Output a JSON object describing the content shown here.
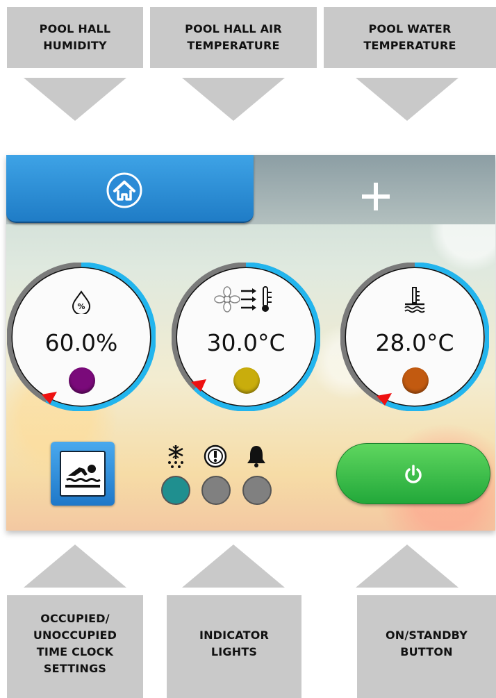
{
  "callouts_top": [
    {
      "label": "POOL HALL\nHUMIDITY"
    },
    {
      "label": "POOL HALL AIR\nTEMPERATURE"
    },
    {
      "label": "POOL WATER\nTEMPERATURE"
    }
  ],
  "callouts_bottom": [
    {
      "label": "OCCUPIED/\nUNOCCUPIED\nTIME CLOCK\nSETTINGS"
    },
    {
      "label": "INDICATOR\nLIGHTS"
    },
    {
      "label": "ON/STANDBY\nBUTTON"
    }
  ],
  "nav": {
    "home_icon": "home-icon",
    "add_icon": "plus-icon"
  },
  "gauges": [
    {
      "icon": "humidity-drop-icon",
      "value": "60.0%",
      "status_color": "#7a0a7a"
    },
    {
      "icon": "fan-thermometer-icon",
      "value": "30.0°C",
      "status_color": "#c9ad0c"
    },
    {
      "icon": "water-thermometer-icon",
      "value": "28.0°C",
      "status_color": "#c25a10"
    }
  ],
  "indicators": [
    {
      "icon": "frost-icon",
      "color": "#1f8f8f"
    },
    {
      "icon": "warning-icon",
      "color": "#808080"
    },
    {
      "icon": "bell-icon",
      "color": "#808080"
    }
  ],
  "colors": {
    "accent_blue": "#1f8fe0",
    "gauge_arc": "#22b5ee",
    "power_green": "#2db84a"
  }
}
